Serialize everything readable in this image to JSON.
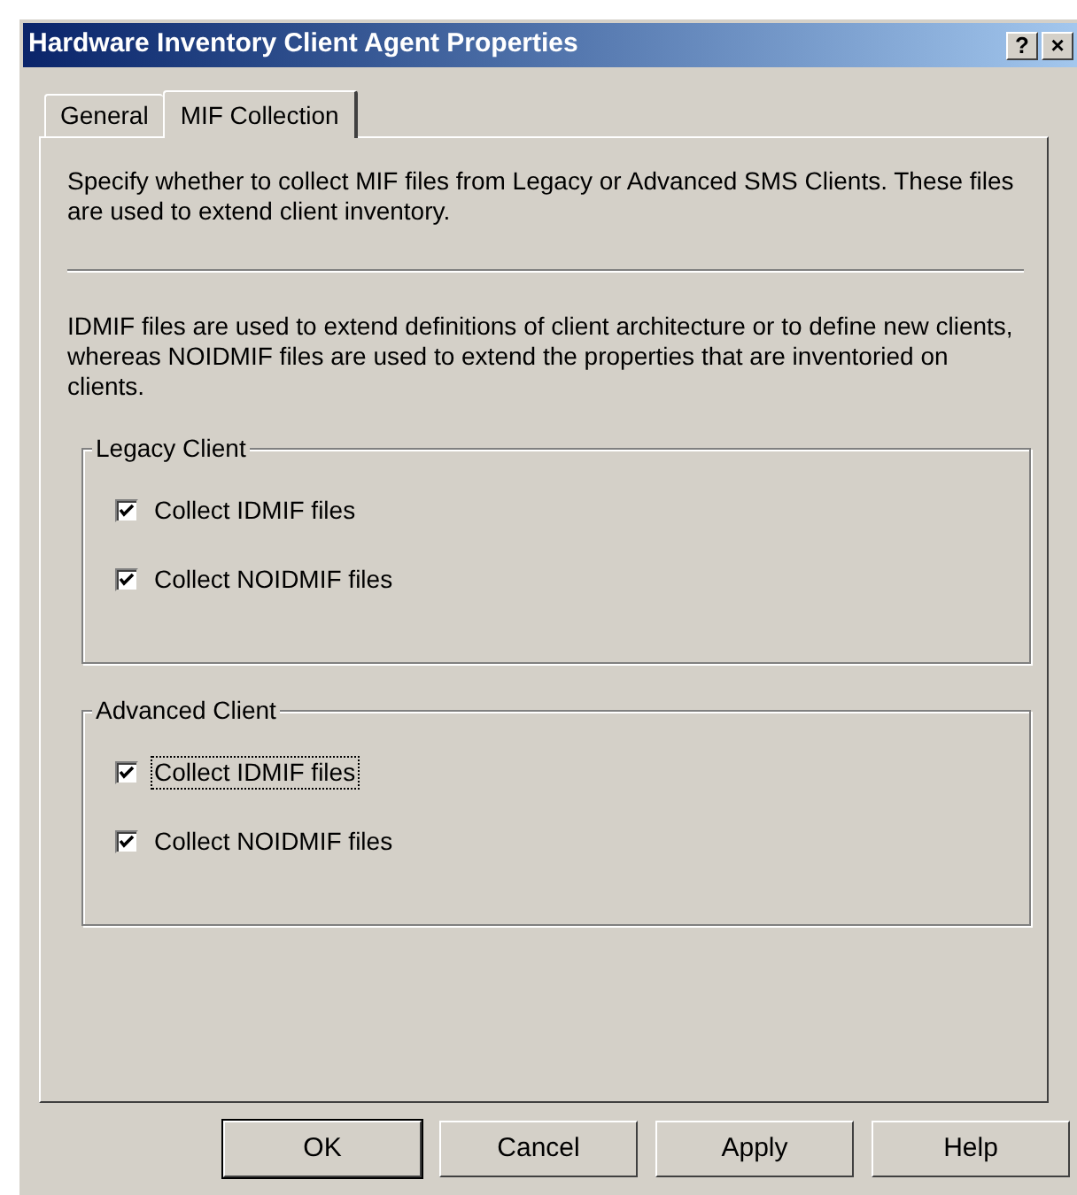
{
  "window": {
    "title": "Hardware Inventory Client Agent Properties",
    "title_buttons": [
      "?",
      "×"
    ]
  },
  "tabs": [
    {
      "label": "General",
      "selected": false
    },
    {
      "label": "MIF Collection",
      "selected": true
    }
  ],
  "intro": "Specify whether to collect MIF files from Legacy or Advanced SMS Clients. These files are used to extend client inventory.",
  "description": "IDMIF files are used to extend definitions of client architecture or to define new clients, whereas NOIDMIF files are used to extend the properties that are inventoried on clients.",
  "groups": [
    {
      "title": "Legacy Client",
      "options": [
        {
          "label": "Collect IDMIF files",
          "checked": true,
          "focused": false
        },
        {
          "label": "Collect NOIDMIF files",
          "checked": true,
          "focused": false
        }
      ]
    },
    {
      "title": "Advanced Client",
      "options": [
        {
          "label": "Collect IDMIF files",
          "checked": true,
          "focused": true
        },
        {
          "label": "Collect NOIDMIF files",
          "checked": true,
          "focused": false
        }
      ]
    }
  ],
  "buttons": [
    {
      "label": "OK",
      "default": true
    },
    {
      "label": "Cancel",
      "default": false
    },
    {
      "label": "Apply",
      "default": false
    },
    {
      "label": "Help",
      "default": false
    }
  ]
}
